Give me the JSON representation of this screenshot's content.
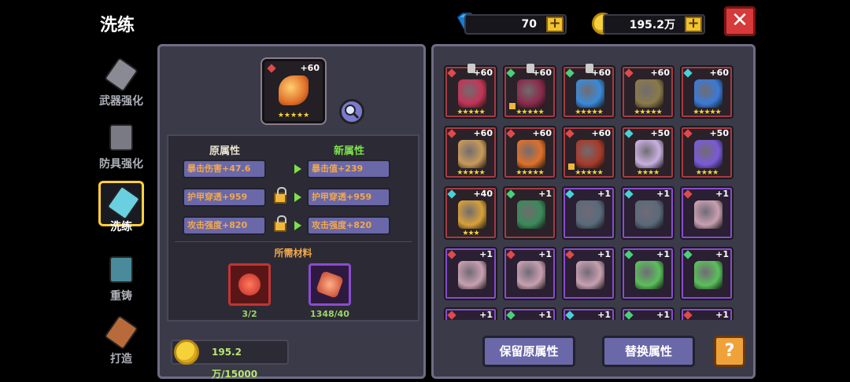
{
  "title": "洗练",
  "currency": {
    "gems": "70",
    "gold": "195.2万"
  },
  "nav": [
    {
      "label": "武器强化",
      "icon": "sword-upgrade-icon",
      "active": false
    },
    {
      "label": "防具强化",
      "icon": "armor-upgrade-icon",
      "active": false
    },
    {
      "label": "洗练",
      "icon": "refine-sword-icon",
      "active": true
    },
    {
      "label": "重铸",
      "icon": "reforge-armor-icon",
      "active": false
    },
    {
      "label": "打造",
      "icon": "forge-hammer-icon",
      "active": false
    }
  ],
  "selected_item": {
    "level": "+60",
    "stars": "★★★★★",
    "icon": "flame-gauntlet-icon"
  },
  "attributes": {
    "old_header": "原属性",
    "new_header": "新属性",
    "rows": [
      {
        "old": "暴击伤害+47.6",
        "new": "暴击值+239",
        "locked": false
      },
      {
        "old": "护甲穿透+959",
        "new": "护甲穿透+959",
        "locked": true
      },
      {
        "old": "攻击强度+820",
        "new": "攻击强度+820",
        "locked": true
      }
    ]
  },
  "materials": {
    "title": "所需材料",
    "items": [
      {
        "count": "3/2",
        "icon": "red-refine-stone-icon"
      },
      {
        "count": "1348/40",
        "icon": "purple-refine-stone-icon"
      }
    ]
  },
  "gold_cost": "195.2万/15000",
  "inventory": [
    {
      "lvl": "+60",
      "stars": "★★★★★",
      "rarity": "red",
      "gem": "#e04a4a",
      "color": "#c23456",
      "pin": true,
      "lock": false
    },
    {
      "lvl": "+60",
      "stars": "★★★★★",
      "rarity": "red",
      "gem": "#4ad07a",
      "color": "#8a2a4a",
      "pin": true,
      "lock": true
    },
    {
      "lvl": "+60",
      "stars": "★★★★★",
      "rarity": "red",
      "gem": "#4ad07a",
      "color": "#3a8ad8",
      "pin": true,
      "lock": false
    },
    {
      "lvl": "+60",
      "stars": "★★★★★",
      "rarity": "red",
      "gem": "#e04a4a",
      "color": "#8a7a4a",
      "pin": false,
      "lock": false
    },
    {
      "lvl": "+60",
      "stars": "★★★★★",
      "rarity": "red",
      "gem": "#4ad0d8",
      "color": "#3a7ad8",
      "pin": false,
      "lock": false
    },
    {
      "lvl": "+60",
      "stars": "★★★★★",
      "rarity": "red",
      "gem": "#e04a4a",
      "color": "#c89a5a",
      "pin": false,
      "lock": false
    },
    {
      "lvl": "+60",
      "stars": "★★★★★",
      "rarity": "red",
      "gem": "#e04a4a",
      "color": "#e0702a",
      "pin": false,
      "lock": false
    },
    {
      "lvl": "+60",
      "stars": "★★★★★",
      "rarity": "red",
      "gem": "#e04a4a",
      "color": "#a83a2a",
      "pin": false,
      "lock": true
    },
    {
      "lvl": "+50",
      "stars": "★★★★",
      "rarity": "red",
      "gem": "#4ad0d8",
      "color": "#c8b0e0",
      "pin": false,
      "lock": false
    },
    {
      "lvl": "+50",
      "stars": "★★★★",
      "rarity": "red",
      "gem": "#e04a4a",
      "color": "#7a5ad8",
      "pin": false,
      "lock": false
    },
    {
      "lvl": "+40",
      "stars": "★★★",
      "rarity": "red",
      "gem": "#4ad0d8",
      "color": "#d8a03a",
      "pin": false,
      "lock": false
    },
    {
      "lvl": "+1",
      "stars": "",
      "rarity": "red",
      "gem": "#4ad07a",
      "color": "#3a8a5a",
      "pin": false,
      "lock": false
    },
    {
      "lvl": "+1",
      "stars": "",
      "rarity": "purple",
      "gem": "#4ad0d8",
      "color": "#5a6a7a",
      "pin": false,
      "lock": false
    },
    {
      "lvl": "+1",
      "stars": "",
      "rarity": "purple",
      "gem": "#4ad0d8",
      "color": "#5a6a7a",
      "pin": false,
      "lock": false
    },
    {
      "lvl": "+1",
      "stars": "",
      "rarity": "purple",
      "gem": "#e04a4a",
      "color": "#c8a0b0",
      "pin": false,
      "lock": false
    },
    {
      "lvl": "+1",
      "stars": "",
      "rarity": "purple",
      "gem": "#e04a4a",
      "color": "#c8a0b0",
      "pin": false,
      "lock": false
    },
    {
      "lvl": "+1",
      "stars": "",
      "rarity": "purple",
      "gem": "#e04a4a",
      "color": "#c8a0b0",
      "pin": false,
      "lock": false
    },
    {
      "lvl": "+1",
      "stars": "",
      "rarity": "purple",
      "gem": "#e04a4a",
      "color": "#c8a0b0",
      "pin": false,
      "lock": false
    },
    {
      "lvl": "+1",
      "stars": "",
      "rarity": "purple",
      "gem": "#4ad07a",
      "color": "#5ac05a",
      "pin": false,
      "lock": false
    },
    {
      "lvl": "+1",
      "stars": "",
      "rarity": "purple",
      "gem": "#4ad07a",
      "color": "#5ac05a",
      "pin": false,
      "lock": false
    },
    {
      "lvl": "+1",
      "stars": "",
      "rarity": "purple",
      "gem": "#e04a4a",
      "color": "#6a4a8a",
      "pin": false,
      "lock": false
    },
    {
      "lvl": "+1",
      "stars": "",
      "rarity": "purple",
      "gem": "#4ad07a",
      "color": "#6a4a8a",
      "pin": false,
      "lock": false
    },
    {
      "lvl": "+1",
      "stars": "",
      "rarity": "purple",
      "gem": "#4ad0d8",
      "color": "#6a4a8a",
      "pin": false,
      "lock": false
    },
    {
      "lvl": "+1",
      "stars": "",
      "rarity": "purple",
      "gem": "#4ad07a",
      "color": "#6a4a8a",
      "pin": false,
      "lock": false
    },
    {
      "lvl": "+1",
      "stars": "",
      "rarity": "purple",
      "gem": "#e04a4a",
      "color": "#6a4a8a",
      "pin": false,
      "lock": false
    }
  ],
  "buttons": {
    "keep": "保留原属性",
    "replace": "替换属性",
    "help": "?"
  }
}
